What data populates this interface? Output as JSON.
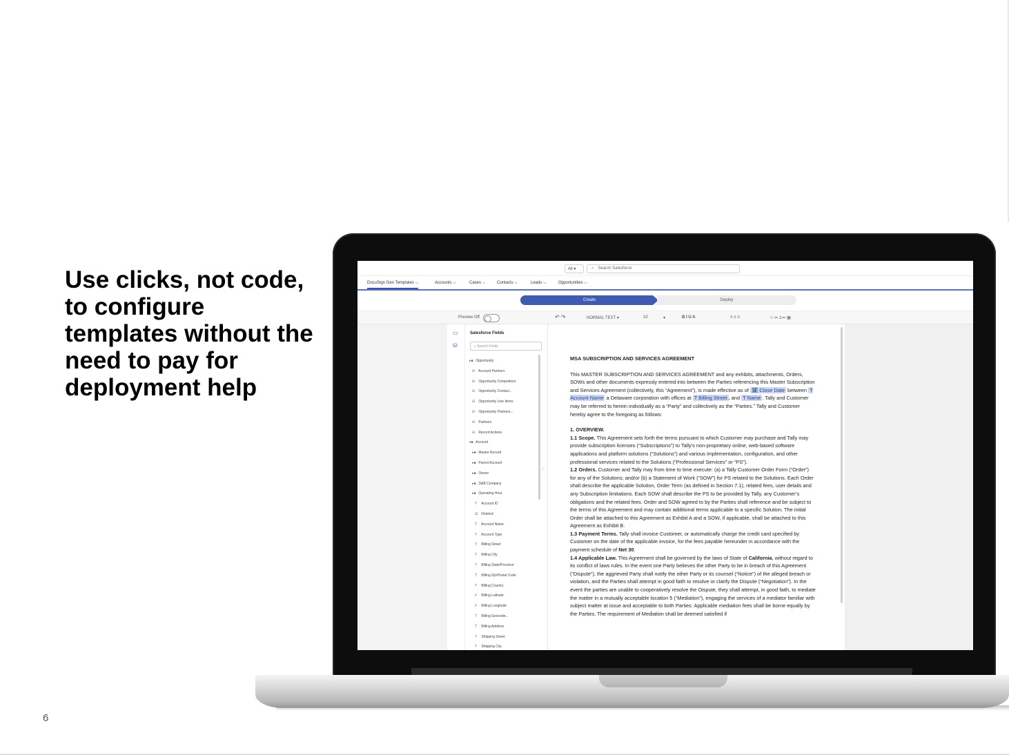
{
  "slide": {
    "headline": "Use clicks, not code, to configure templates without the need to pay for deployment help",
    "page_number": "6"
  },
  "app": {
    "search": {
      "scope": "All ▾",
      "placeholder": "Search Salesforce"
    },
    "nav_tabs": [
      {
        "label": "DocuSign Gen Templates ⌵"
      },
      {
        "label": "Accounts ⌵"
      },
      {
        "label": "Cases ⌵"
      },
      {
        "label": "Contacts ⌵"
      },
      {
        "label": "Leads ⌵"
      },
      {
        "label": "Opportunities ⌵"
      }
    ],
    "steps": {
      "create": "Create",
      "deploy": "Deploy"
    },
    "toolbar": {
      "preview_label": "Preview Off",
      "undo_redo": "↶ ↷",
      "style": "NORMAL TEXT ▾",
      "font_size": "10",
      "font_size_caret": "▾",
      "format": "B  I  U  A",
      "align": "≡  ≡  ≡",
      "misc": "⁝⁝   ≔  1≔  ▦"
    },
    "fields_panel": {
      "title": "Salesforce Fields",
      "search_placeholder": "Search Fields",
      "items": [
        {
          "icon": "▸■",
          "label": "Opportunity"
        },
        {
          "icon": "⛁",
          "label": "Account Partners"
        },
        {
          "icon": "⛁",
          "label": "Opportunity Competitors"
        },
        {
          "icon": "⛁",
          "label": "Opportunity Contact..."
        },
        {
          "icon": "⛁",
          "label": "Opportunity Line Items"
        },
        {
          "icon": "⛁",
          "label": "Opportunity Partners..."
        },
        {
          "icon": "⛁",
          "label": "Partners"
        },
        {
          "icon": "⛁",
          "label": "Record Actions"
        },
        {
          "icon": "▾■",
          "label": "Account"
        },
        {
          "icon": "▸■",
          "label": "Master Record"
        },
        {
          "icon": "▸■",
          "label": "Parent Account"
        },
        {
          "icon": "▸■",
          "label": "Owner"
        },
        {
          "icon": "▸■",
          "label": "D&B Company"
        },
        {
          "icon": "▸■",
          "label": "Operating Hour"
        },
        {
          "icon": "T",
          "label": "Account ID"
        },
        {
          "icon": "☰",
          "label": "Deleted"
        },
        {
          "icon": "T",
          "label": "Account Name"
        },
        {
          "icon": "T",
          "label": "Account Type"
        },
        {
          "icon": "T",
          "label": "Billing Street"
        },
        {
          "icon": "T",
          "label": "Billing City"
        },
        {
          "icon": "T",
          "label": "Billing State/Province"
        },
        {
          "icon": "T",
          "label": "Billing Zip/Postal Code"
        },
        {
          "icon": "T",
          "label": "Billing Country"
        },
        {
          "icon": "#",
          "label": "Billing Latitude"
        },
        {
          "icon": "#",
          "label": "Billing Longitude"
        },
        {
          "icon": "T",
          "label": "Billing Geocode..."
        },
        {
          "icon": "T",
          "label": "Billing Address"
        },
        {
          "icon": "T",
          "label": "Shipping Street"
        },
        {
          "icon": "T",
          "label": "Shipping City"
        }
      ]
    },
    "document": {
      "heading": "MSA SUBSCRIPTION AND SERVICES AGREEMENT",
      "intro_a": "This MASTER SUBSCRIPTION AND SERVICES AGREEMENT and any exhibits, attachments, Orders, SOWs and other documents expressly entered into between the Parties referencing this Master Subscription and Services Agreement (collectively, this “Agreement”), is made effective as of",
      "chip_close_date": "🗓 Close Date",
      "intro_b": "between",
      "chip_account_name": "T Account Name",
      "intro_c": "a Delaware corporation with offices at",
      "chip_billing_street": "T Billing Street",
      "intro_d": ", and",
      "chip_name": "T Name",
      "intro_e": ". Tally and Customer may be referred to herein individually as a “Party” and collectively as the “Parties.” Tally and Customer hereby agree to the foregoing as follows:",
      "overview": "1.    OVERVIEW.",
      "s11_title": "1.1 Scope.",
      "s11_body": "This Agreement sets forth the terms pursuant to which Customer may purchase and Tally may provide subscription licenses (“Subscriptions”) to Tally’s non-proprietary online, web-based software applications and platform solutions (“Solutions”) and various implementation, configuration, and other professional services related to the Solutions (“Professional Services” or “PS”).",
      "s12_title": "1.2 Orders.",
      "s12_body": "Customer and Tally may from time to time execute: (a) a Tally Customer Order Form (“Order”) for any of the Solutions; and/or (b) a Statement of Work (“SOW”) for PS related to the Solutions. Each Order shall describe the applicable Solution, Order Term (as defined in Section 7.1), related fees, user details and any Subscription limitations. Each SOW shall describe the PS to be provided by Tally, any Customer’s obligations and the related fees. Order and SOW agreed to by the Parties shall reference and be subject to the terms of this Agreement and may contain additional terms applicable to a specific Solution. The initial Order shall be attached to this Agreement as Exhibit A and a SOW, if applicable, shall be attached to this Agreement as Exhibit B.",
      "s13_title": "1.3 Payment Terms.",
      "s13_body": "Tally shall invoice Customer, or automatically charge the credit card specified by Customer on the date of the applicable invoice, for the fees payable hereunder in accordance with the payment schedule of",
      "s13_net": "Net 30",
      "s14_title": "1.4 Applicable Law.",
      "s14_body_a": "This Agreement shall be governed by the laws of State of",
      "s14_state": "California",
      "s14_body_b": ", without regard to its conflict of laws rules. In the event one Party believes the other Party to be in breach of this Agreement (“Dispute”), the aggrieved Party shall notify the other Party or its counsel (“Notice”) of the alleged breach or violation, and the Parties shall attempt in good faith to resolve or clarify the Dispute (“Negotiation”). In the event the parties are unable to cooperatively resolve the Dispute, they shall attempt, in good faith, to mediate the matter in a mutually acceptable location 5 (“Mediation”), engaging the services of a mediator familiar with subject matter at issue and acceptable to both Parties. Applicable mediation fees shall be borne equally by the Parties. The requirement of Mediation shall be deemed satisfied if"
    }
  },
  "colors": {
    "accent": "#3f5cb0",
    "chip_bg": "#c9d7f2"
  }
}
